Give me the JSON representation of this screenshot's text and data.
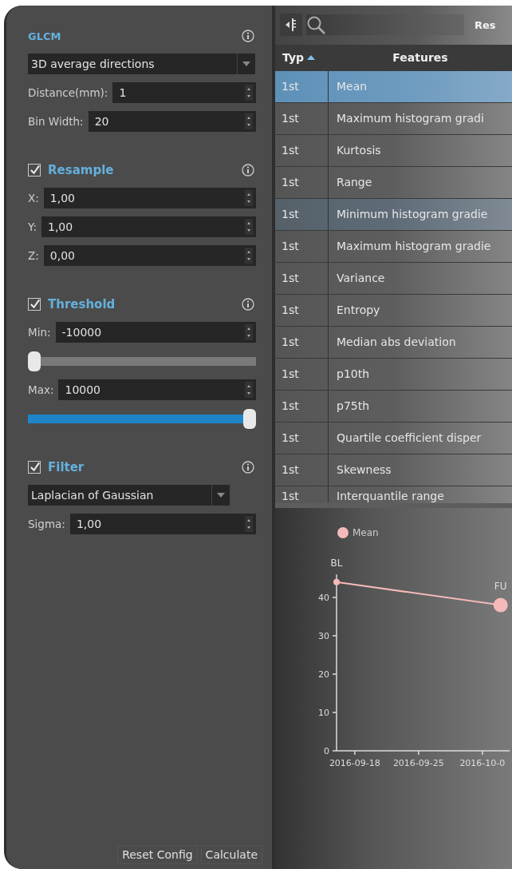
{
  "settings": {
    "sections": [
      {
        "kind": "plain",
        "title": "GLCM",
        "fields": [
          {
            "kind": "dropdown",
            "value": "3D average directions"
          },
          {
            "kind": "spin",
            "label": "Distance(mm):",
            "value": "1"
          },
          {
            "kind": "spin",
            "label": "Bin Width:",
            "value": "20"
          }
        ]
      },
      {
        "kind": "checkable",
        "title": "Resample",
        "checked": true,
        "fields": [
          {
            "kind": "spin",
            "label": "X:",
            "value": "1,00"
          },
          {
            "kind": "spin",
            "label": "Y:",
            "value": "1,00"
          },
          {
            "kind": "spin",
            "label": "Z:",
            "value": "0,00"
          }
        ]
      },
      {
        "kind": "checkable",
        "title": "Threshold",
        "checked": true,
        "fields": [
          {
            "kind": "spin",
            "label": "Min:",
            "value": "-10000"
          },
          {
            "kind": "slider",
            "level": 0
          },
          {
            "kind": "spin",
            "label": "Max:",
            "value": "10000"
          },
          {
            "kind": "slider",
            "level": 1
          }
        ]
      },
      {
        "kind": "checkable",
        "title": "Filter",
        "checked": true,
        "fields": [
          {
            "kind": "dropdown",
            "value": "Laplacian of Gaussian"
          },
          {
            "kind": "spin",
            "label": "Sigma:",
            "value": "1,00"
          }
        ]
      }
    ],
    "buttons": [
      "Reset Config",
      "Calculate"
    ]
  },
  "toolbar": {
    "button": "Res"
  },
  "table": {
    "columns": [
      "Typ",
      "Features"
    ],
    "rows": [
      {
        "cells": [
          "1st",
          "Mean"
        ],
        "selected": true,
        "hovered": false
      },
      {
        "cells": [
          "1st",
          "Maximum histogram gradi"
        ],
        "selected": false,
        "hovered": false
      },
      {
        "cells": [
          "1st",
          "Kurtosis"
        ],
        "selected": false,
        "hovered": false
      },
      {
        "cells": [
          "1st",
          "Range"
        ],
        "selected": false,
        "hovered": false
      },
      {
        "cells": [
          "1st",
          "Minimum histogram gradie"
        ],
        "selected": false,
        "hovered": true
      },
      {
        "cells": [
          "1st",
          "Maximum histogram gradie"
        ],
        "selected": false,
        "hovered": false
      },
      {
        "cells": [
          "1st",
          "Variance"
        ],
        "selected": false,
        "hovered": false
      },
      {
        "cells": [
          "1st",
          "Entropy"
        ],
        "selected": false,
        "hovered": false
      },
      {
        "cells": [
          "1st",
          "Median abs deviation"
        ],
        "selected": false,
        "hovered": false
      },
      {
        "cells": [
          "1st",
          "p10th"
        ],
        "selected": false,
        "hovered": false
      },
      {
        "cells": [
          "1st",
          "p75th"
        ],
        "selected": false,
        "hovered": false
      },
      {
        "cells": [
          "1st",
          "Quartile coefficient disper"
        ],
        "selected": false,
        "hovered": false
      },
      {
        "cells": [
          "1st",
          "Skewness"
        ],
        "selected": false,
        "hovered": false
      },
      {
        "cells": [
          "1st",
          "Interquantile range"
        ],
        "selected": false,
        "hovered": false
      }
    ]
  },
  "chart": {
    "chart_data": {
      "type": "line",
      "x": [
        "2016-09-16",
        "2016-10-04"
      ],
      "series": [
        {
          "name": "Mean",
          "color": "#f4b9b9",
          "marker": "circle",
          "values": [
            44,
            38
          ]
        }
      ],
      "xlim": [
        "2016-09-16",
        "2016-10-05"
      ],
      "ylim": [
        0,
        46
      ],
      "yticks": [
        0,
        10,
        20,
        30,
        40
      ],
      "xticks": [
        {
          "value": "2016-09-18",
          "label": "2016-09-18"
        },
        {
          "value": "2016-09-25",
          "label": "2016-09-25"
        },
        {
          "value": "2016-10-02",
          "label": "2016-10-0"
        }
      ],
      "annotations": [
        "BL",
        "FU"
      ]
    }
  }
}
